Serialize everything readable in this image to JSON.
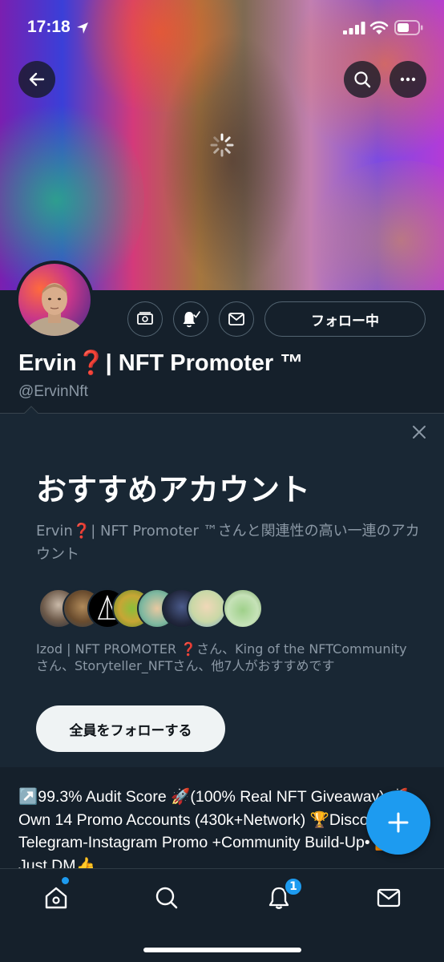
{
  "status_bar": {
    "time": "17:18"
  },
  "profile": {
    "name": "Ervin🅰| NFT Promoter ™",
    "name_display": "Ervin❓| NFT Promoter ™",
    "handle": "@ErvinNft",
    "follow_label": "フォロー中"
  },
  "suggestions": {
    "title": "おすすめアカウント",
    "description": "Ervin❓| NFT Promoter ™さんと関連性の高い一連のアカウント",
    "names": "Izod | NFT PROMOTER ❓さん、King of the NFTCommunityさん、Storyteller_NFTさん、他7人がおすすめです",
    "follow_all_label": "全員をフォローする",
    "avatar_count": 8
  },
  "bio": {
    "text": "↗️99.3% Audit Score 🚀(100% Real NFT Giveaway) 🚀Own 14 Promo Accounts (430k+Network) 🏆Discord-Telegram-Instagram Promo +Community Build-Up• ▶️ Just DM👍"
  },
  "tabbar": {
    "notifications_badge": "1"
  },
  "colors": {
    "background": "#15202b",
    "card": "#192734",
    "accent": "#1d9bf0",
    "muted_text": "#8b98a5",
    "border": "#536471"
  }
}
